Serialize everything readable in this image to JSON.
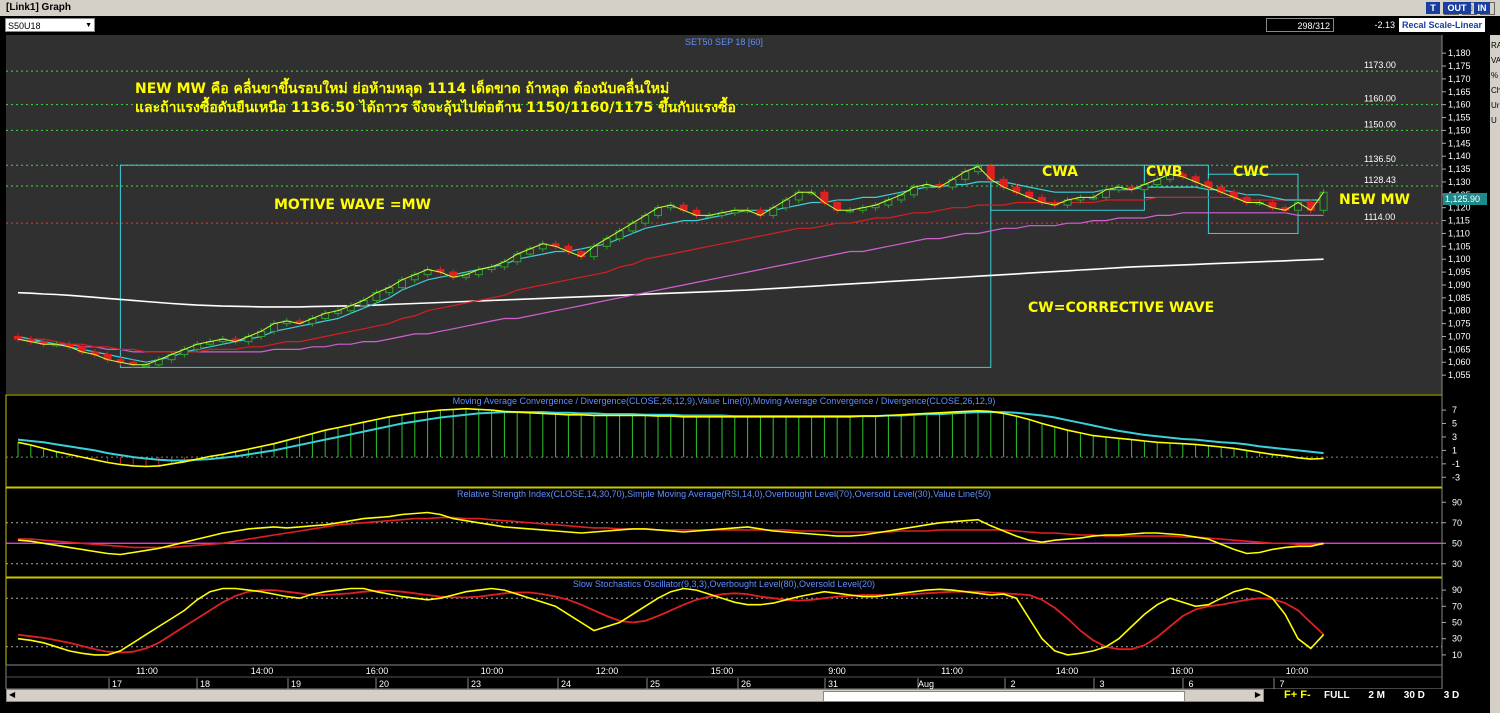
{
  "window": {
    "title": "[Link1] Graph",
    "btn_min": "_",
    "btn_max": "□",
    "btn_close": "×"
  },
  "toolbar": {
    "symbol": "S50U18",
    "bar_position": "298/312",
    "change": "-2.13",
    "recal_label": "Recal Scale-Linear",
    "btn_t": "T",
    "btn_out": "OUT",
    "btn_in": "IN"
  },
  "sidebar": {
    "labels": [
      "RA",
      "VA",
      "%",
      "Ch",
      "Ur",
      "U"
    ]
  },
  "colors": {
    "background": "#000000",
    "price_panel_bg": "#303030",
    "up_candle": "#2ea02e",
    "down_candle": "#e02020",
    "ema_fast": "#3ad0d8",
    "ema_mid": "#d22020",
    "ema_slow": "#d060d0",
    "ma_long": "#ffffff",
    "annotation": "#ffff00",
    "trend_line": "#c8ff32",
    "box": "#3ad0d8"
  },
  "chart_data": [
    {
      "type": "candlestick",
      "title": "SET50 SEP 18  [60]",
      "current_price": "1,125.90",
      "ylim": [
        1050,
        1182
      ],
      "y_ticks": [
        "1,180",
        "1,175",
        "1,170",
        "1,165",
        "1,160",
        "1,155",
        "1,150",
        "1,145",
        "1,140",
        "1,135",
        "1,130",
        "1,125",
        "1,120",
        "1,115",
        "1,110",
        "1,105",
        "1,100",
        "1,095",
        "1,090",
        "1,085",
        "1,080",
        "1,075",
        "1,070",
        "1,065",
        "1,060",
        "1,055"
      ],
      "closes": [
        1069,
        1068,
        1067,
        1067,
        1066,
        1064,
        1063,
        1061,
        1060,
        1059,
        1059,
        1061,
        1063,
        1065,
        1067,
        1068,
        1069,
        1068,
        1070,
        1072,
        1075,
        1076,
        1075,
        1077,
        1079,
        1080,
        1082,
        1084,
        1087,
        1089,
        1092,
        1094,
        1096,
        1095,
        1093,
        1094,
        1096,
        1097,
        1099,
        1102,
        1104,
        1106,
        1105,
        1103,
        1101,
        1105,
        1108,
        1111,
        1114,
        1117,
        1120,
        1121,
        1119,
        1117,
        1117,
        1118,
        1119,
        1119,
        1117,
        1120,
        1123,
        1126,
        1126,
        1122,
        1119,
        1119,
        1120,
        1121,
        1123,
        1125,
        1128,
        1129,
        1128,
        1131,
        1134,
        1136,
        1131,
        1128,
        1126,
        1124,
        1122,
        1121,
        1123,
        1124,
        1124,
        1127,
        1128,
        1127,
        1129,
        1131,
        1133,
        1132,
        1130,
        1128,
        1126,
        1124,
        1122,
        1122,
        1120,
        1119,
        1122,
        1119,
        1126
      ],
      "ema_fast": [
        1070,
        1069,
        1068,
        1067,
        1066,
        1065,
        1064,
        1063,
        1062,
        1061,
        1060,
        1061,
        1062,
        1064,
        1065,
        1066,
        1067,
        1068,
        1069,
        1070,
        1072,
        1073,
        1074,
        1075,
        1076,
        1077,
        1079,
        1081,
        1083,
        1085,
        1088,
        1090,
        1092,
        1093,
        1094,
        1095,
        1096,
        1097,
        1098,
        1100,
        1101,
        1102,
        1103,
        1103,
        1104,
        1105,
        1106,
        1108,
        1110,
        1112,
        1113,
        1114,
        1115,
        1115,
        1116,
        1117,
        1118,
        1119,
        1119,
        1119,
        1120,
        1121,
        1122,
        1122,
        1123,
        1123,
        1124,
        1124,
        1125,
        1126,
        1127,
        1128,
        1128,
        1129,
        1129,
        1130,
        1130,
        1130,
        1129,
        1128,
        1127,
        1126,
        1126,
        1126,
        1126,
        1127,
        1127,
        1127,
        1128,
        1128,
        1128,
        1128,
        1128,
        1127,
        1127,
        1126,
        1125,
        1125,
        1124,
        1123,
        1123,
        1123,
        1123
      ],
      "ema_mid": [
        1070,
        1069,
        1069,
        1068,
        1067,
        1067,
        1066,
        1066,
        1065,
        1065,
        1064,
        1064,
        1064,
        1064,
        1064,
        1065,
        1065,
        1065,
        1066,
        1066,
        1067,
        1068,
        1068,
        1069,
        1070,
        1071,
        1072,
        1073,
        1074,
        1075,
        1077,
        1078,
        1080,
        1081,
        1082,
        1083,
        1084,
        1085,
        1086,
        1088,
        1089,
        1090,
        1091,
        1092,
        1093,
        1094,
        1095,
        1097,
        1098,
        1100,
        1101,
        1102,
        1103,
        1104,
        1105,
        1106,
        1107,
        1108,
        1109,
        1110,
        1111,
        1112,
        1112,
        1113,
        1114,
        1114,
        1115,
        1116,
        1116,
        1117,
        1118,
        1118,
        1119,
        1120,
        1120,
        1121,
        1121,
        1121,
        1122,
        1122,
        1122,
        1122,
        1122,
        1122,
        1122,
        1123,
        1123,
        1123,
        1123,
        1124,
        1124,
        1124,
        1124,
        1124,
        1124,
        1124,
        1123,
        1123,
        1123,
        1123,
        1123,
        1122,
        1122
      ],
      "ema_slow": [
        1069,
        1068,
        1068,
        1067,
        1067,
        1066,
        1066,
        1065,
        1065,
        1064,
        1064,
        1064,
        1064,
        1064,
        1064,
        1064,
        1064,
        1064,
        1064,
        1064,
        1065,
        1065,
        1065,
        1066,
        1066,
        1067,
        1067,
        1068,
        1068,
        1069,
        1070,
        1071,
        1071,
        1072,
        1073,
        1074,
        1075,
        1076,
        1077,
        1077,
        1078,
        1079,
        1080,
        1081,
        1082,
        1083,
        1084,
        1085,
        1086,
        1087,
        1088,
        1089,
        1090,
        1091,
        1092,
        1093,
        1094,
        1095,
        1096,
        1097,
        1098,
        1099,
        1100,
        1101,
        1102,
        1103,
        1103,
        1104,
        1105,
        1106,
        1107,
        1108,
        1108,
        1109,
        1110,
        1110,
        1111,
        1112,
        1112,
        1113,
        1113,
        1113,
        1114,
        1114,
        1115,
        1115,
        1116,
        1116,
        1116,
        1117,
        1117,
        1118,
        1118,
        1118,
        1118,
        1118,
        1118,
        1118,
        1118,
        1118,
        1117,
        1117,
        1117
      ],
      "ma_long": [
        1087,
        1086.8,
        1086.5,
        1086.3,
        1086,
        1085.6,
        1085.2,
        1084.8,
        1084.4,
        1084,
        1083.6,
        1083.2,
        1082.8,
        1082.5,
        1082.2,
        1082,
        1081.8,
        1081.7,
        1081.6,
        1081.5,
        1081.5,
        1081.5,
        1081.5,
        1081.6,
        1081.7,
        1081.8,
        1081.9,
        1082,
        1082.2,
        1082.4,
        1082.6,
        1082.8,
        1083,
        1083.2,
        1083.4,
        1083.6,
        1083.8,
        1084,
        1084.2,
        1084.4,
        1084.6,
        1084.8,
        1085,
        1085.2,
        1085.4,
        1085.6,
        1085.8,
        1086,
        1086.2,
        1086.4,
        1086.6,
        1086.8,
        1087,
        1087.2,
        1087.4,
        1087.6,
        1087.8,
        1088,
        1088.3,
        1088.6,
        1088.9,
        1089.2,
        1089.5,
        1089.8,
        1090.1,
        1090.4,
        1090.7,
        1091,
        1091.3,
        1091.6,
        1091.9,
        1092.2,
        1092.5,
        1092.8,
        1093.1,
        1093.4,
        1093.7,
        1094,
        1094.3,
        1094.6,
        1094.9,
        1095.2,
        1095.5,
        1095.8,
        1096.1,
        1096.4,
        1096.7,
        1097,
        1097.2,
        1097.4,
        1097.6,
        1097.8,
        1098,
        1098.2,
        1098.4,
        1098.6,
        1098.8,
        1099,
        1099.2,
        1099.4,
        1099.6,
        1099.8,
        1100
      ],
      "price_levels": [
        {
          "label": "1173.00",
          "value": 1173,
          "color": "#3cdc3c"
        },
        {
          "label": "1160.00",
          "value": 1160,
          "color": "#3cdc3c"
        },
        {
          "label": "1150.00",
          "value": 1150,
          "color": "#3cdc3c"
        },
        {
          "label": "1136.50",
          "value": 1136.5,
          "color": "#3cdc3c"
        },
        {
          "label": "1128.43",
          "value": 1128.43,
          "color": "#3cdc3c"
        },
        {
          "label": "1114.00",
          "value": 1114,
          "color": "#ff3030"
        }
      ],
      "annotations": {
        "line1": "NEW MW คือ คลื่นขาขึ้นรอบใหม่  ย่อห้ามหลุด 1114 เด็ดขาด ถ้าหลุด ต้องนับคลื่นใหม่",
        "line2": "และถ้าแรงซื้อดันยืนเหนือ 1136.50 ได้ถาวร จึงจะลุ้นไปต่อต้าน 1150/1160/1175 ขึ้นกับแรงซื้อ",
        "motive": "MOTIVE WAVE =MW",
        "corrective": "CW=CORRECTIVE WAVE",
        "cwa": "CWA",
        "cwb": "CWB",
        "cwc": "CWC",
        "new_mw": "NEW MW"
      }
    },
    {
      "type": "macd",
      "title": "Moving Average Convergence / Divergence(CLOSE,26,12,9),Value Line(0),Moving Average Convergence / Divergence(CLOSE,26,12,9)",
      "ylim": [
        -4,
        8.5
      ],
      "y_ticks": [
        "7",
        "5",
        "3",
        "1",
        "-1",
        "-3"
      ],
      "macd": [
        2.2,
        1.8,
        1.3,
        0.8,
        0.4,
        0,
        -0.4,
        -0.8,
        -1.1,
        -1.3,
        -1.4,
        -1.3,
        -1,
        -0.7,
        -0.3,
        0.1,
        0.4,
        0.8,
        1.2,
        1.6,
        2,
        2.5,
        3,
        3.5,
        4,
        4.4,
        4.8,
        5.2,
        5.6,
        6,
        6.3,
        6.6,
        6.8,
        7,
        7.1,
        7.2,
        7.1,
        7,
        6.8,
        6.7,
        6.6,
        6.5,
        6.4,
        6.3,
        6.3,
        6.2,
        6.2,
        6.2,
        6.2,
        6.2,
        6.1,
        6.1,
        6,
        6,
        6,
        6,
        6,
        6,
        6,
        6,
        6,
        6,
        6,
        6,
        6,
        6,
        6.1,
        6.1,
        6.2,
        6.3,
        6.4,
        6.5,
        6.6,
        6.7,
        6.8,
        6.9,
        6.8,
        6.5,
        6.1,
        5.6,
        5,
        4.5,
        4,
        3.6,
        3.2,
        3,
        2.8,
        2.6,
        2.4,
        2.2,
        2.1,
        2,
        1.9,
        1.7,
        1.5,
        1.3,
        1,
        0.7,
        0.4,
        0.2,
        -0.1,
        -0.3,
        -0.2
      ],
      "signal": [
        2.6,
        2.4,
        2.2,
        1.9,
        1.6,
        1.3,
        1,
        0.6,
        0.3,
        0,
        -0.2,
        -0.4,
        -0.5,
        -0.5,
        -0.4,
        -0.3,
        -0.1,
        0.1,
        0.4,
        0.7,
        1,
        1.4,
        1.8,
        2.2,
        2.6,
        3,
        3.4,
        3.8,
        4.2,
        4.6,
        5,
        5.3,
        5.6,
        5.9,
        6.1,
        6.3,
        6.5,
        6.6,
        6.7,
        6.7,
        6.7,
        6.7,
        6.6,
        6.6,
        6.5,
        6.5,
        6.4,
        6.4,
        6.4,
        6.3,
        6.3,
        6.3,
        6.2,
        6.2,
        6.2,
        6.2,
        6.1,
        6.1,
        6.1,
        6.1,
        6.1,
        6.1,
        6.1,
        6.1,
        6.1,
        6.1,
        6.1,
        6.1,
        6.2,
        6.2,
        6.3,
        6.4,
        6.4,
        6.5,
        6.6,
        6.7,
        6.7,
        6.7,
        6.6,
        6.4,
        6.2,
        5.9,
        5.5,
        5.1,
        4.7,
        4.3,
        3.9,
        3.6,
        3.3,
        3.1,
        2.9,
        2.7,
        2.6,
        2.4,
        2.2,
        2.1,
        1.9,
        1.6,
        1.4,
        1.2,
        1,
        0.8,
        0.6
      ]
    },
    {
      "type": "rsi",
      "title": "Relative Strength Index(CLOSE,14,30,70),Simple Moving Average(RSI,14,0),Overbought Level(70),Oversold Level(30),Value Line(50)",
      "ylim": [
        20,
        100
      ],
      "y_ticks": [
        "90",
        "70",
        "50",
        "30"
      ],
      "rsi": [
        53,
        52,
        50,
        48,
        46,
        44,
        42,
        40,
        39,
        41,
        43,
        45,
        48,
        51,
        54,
        57,
        60,
        62,
        64,
        65,
        66,
        65,
        66,
        67,
        68,
        70,
        72,
        74,
        75,
        76,
        78,
        79,
        80,
        78,
        74,
        72,
        70,
        68,
        66,
        65,
        64,
        63,
        62,
        61,
        60,
        61,
        62,
        63,
        64,
        64,
        63,
        62,
        61,
        62,
        63,
        64,
        65,
        66,
        64,
        62,
        61,
        60,
        59,
        58,
        57,
        57,
        58,
        60,
        62,
        64,
        66,
        68,
        70,
        71,
        72,
        73,
        67,
        62,
        57,
        53,
        51,
        53,
        54,
        55,
        57,
        58,
        58,
        59,
        60,
        60,
        59,
        58,
        56,
        54,
        49,
        44,
        40,
        41,
        44,
        46,
        47,
        47,
        50
      ],
      "sma": [
        54,
        54,
        53,
        52,
        51,
        50,
        49,
        48,
        47,
        46,
        46,
        46,
        46,
        47,
        48,
        49,
        50,
        52,
        54,
        56,
        58,
        60,
        62,
        64,
        66,
        68,
        69,
        70,
        71,
        72,
        73,
        74,
        74,
        75,
        75,
        74,
        74,
        73,
        72,
        71,
        70,
        69,
        68,
        67,
        66,
        65,
        65,
        64,
        64,
        64,
        63,
        63,
        63,
        63,
        63,
        63,
        63,
        63,
        63,
        63,
        63,
        62,
        62,
        62,
        61,
        61,
        61,
        61,
        61,
        62,
        62,
        62,
        63,
        63,
        63,
        63,
        63,
        63,
        62,
        61,
        60,
        60,
        59,
        58,
        58,
        57,
        57,
        57,
        57,
        57,
        57,
        56,
        56,
        55,
        54,
        53,
        52,
        51,
        50,
        50,
        49,
        49,
        49
      ]
    },
    {
      "type": "stochastic",
      "title": "Slow Stochastics Oscillator(9,3,3),Overbought Level(80),Oversold Level(20)",
      "ylim": [
        0,
        100
      ],
      "y_ticks": [
        "90",
        "70",
        "50",
        "30",
        "10"
      ],
      "k": [
        30,
        28,
        25,
        20,
        15,
        12,
        10,
        10,
        15,
        25,
        35,
        45,
        55,
        65,
        78,
        88,
        92,
        92,
        90,
        88,
        85,
        82,
        80,
        85,
        88,
        90,
        92,
        92,
        88,
        85,
        82,
        80,
        78,
        80,
        84,
        88,
        90,
        92,
        90,
        85,
        80,
        75,
        70,
        60,
        50,
        40,
        45,
        50,
        60,
        70,
        80,
        88,
        92,
        90,
        85,
        80,
        75,
        72,
        72,
        74,
        78,
        82,
        85,
        88,
        86,
        84,
        82,
        82,
        84,
        86,
        88,
        90,
        91,
        90,
        88,
        86,
        84,
        85,
        80,
        55,
        30,
        15,
        10,
        12,
        15,
        20,
        30,
        45,
        60,
        72,
        80,
        75,
        70,
        72,
        80,
        88,
        92,
        88,
        80,
        60,
        30,
        18,
        35
      ],
      "d": [
        35,
        33,
        31,
        28,
        25,
        21,
        17,
        14,
        13,
        14,
        18,
        25,
        35,
        45,
        55,
        65,
        75,
        83,
        88,
        90,
        90,
        88,
        86,
        84,
        84,
        85,
        86,
        88,
        89,
        89,
        88,
        86,
        84,
        82,
        81,
        81,
        82,
        84,
        86,
        87,
        87,
        85,
        82,
        78,
        72,
        65,
        58,
        52,
        50,
        52,
        58,
        65,
        72,
        78,
        82,
        85,
        86,
        85,
        82,
        80,
        78,
        77,
        78,
        80,
        82,
        83,
        84,
        84,
        84,
        84,
        85,
        86,
        87,
        88,
        88,
        88,
        87,
        86,
        85,
        84,
        78,
        68,
        55,
        40,
        28,
        20,
        17,
        17,
        22,
        32,
        45,
        58,
        66,
        70,
        72,
        75,
        78,
        80,
        79,
        74,
        65,
        50,
        35
      ]
    }
  ],
  "x_axis": {
    "times": [
      "11:00",
      "14:00",
      "16:00",
      "10:00",
      "12:00",
      "15:00",
      "9:00",
      "11:00",
      "14:00",
      "16:00",
      "10:00"
    ],
    "dates": [
      "17",
      "18",
      "19",
      "20",
      "23",
      "24",
      "25",
      "26",
      "31",
      "Aug",
      "2",
      "3",
      "6",
      "7"
    ]
  },
  "bottombar": {
    "scroll_left": "◀",
    "scroll_right": "▶",
    "f_plus": "F+",
    "f_minus": "F-",
    "periods": [
      "FULL",
      "2 M",
      "30 D",
      "3 D"
    ]
  }
}
